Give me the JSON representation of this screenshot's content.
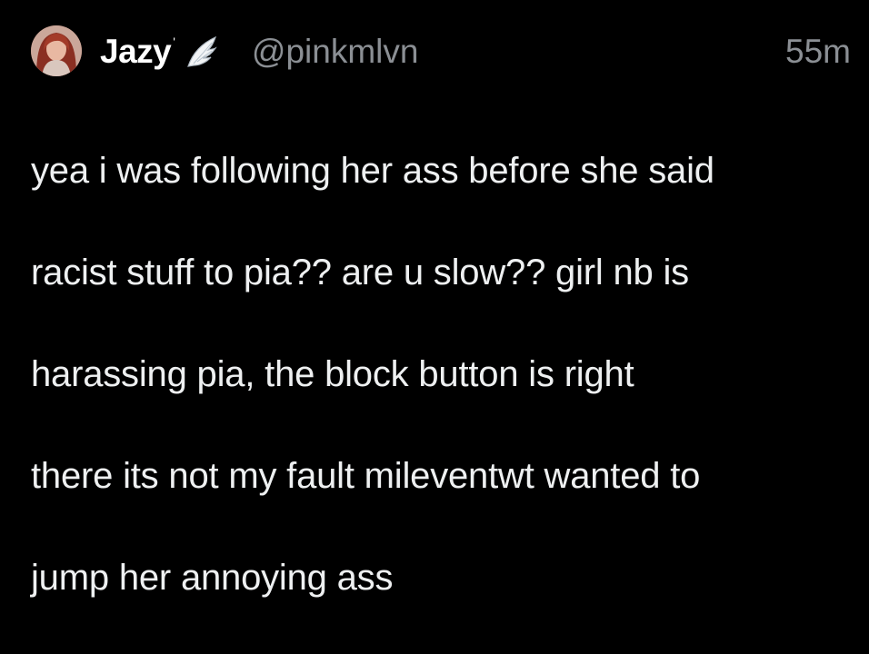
{
  "tweet": {
    "author": {
      "display_name": "Jazy",
      "name_mark": "'",
      "badge_icon": "angel-wing-icon",
      "handle": "@pinkmlvn"
    },
    "timestamp": "55m",
    "text_lines": [
      "yea i was following her ass before she said",
      "racist stuff to pia?? are u slow?? girl nb is",
      "harassing pia, the block button is right",
      "there its not my fault mileventwt wanted to",
      "jump her annoying ass"
    ]
  },
  "colors": {
    "background": "#000000",
    "name": "#ffffff",
    "secondary_text": "#8b8f94",
    "body_text": "#eef0f1"
  }
}
